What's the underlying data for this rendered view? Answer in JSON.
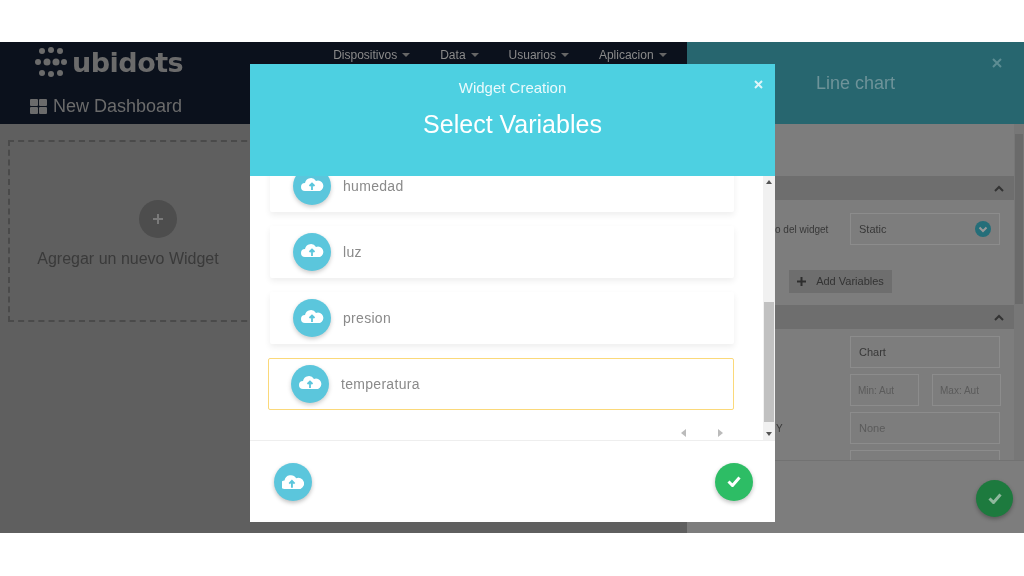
{
  "header": {
    "logo": "ubidots",
    "dashboard_title": "New Dashboard",
    "nav": [
      {
        "label": "Dispositivos"
      },
      {
        "label": "Data"
      },
      {
        "label": "Usuarios"
      },
      {
        "label": "Aplicacion"
      }
    ]
  },
  "dashboard": {
    "add_widget": "Agregar un nuevo Widget"
  },
  "panel": {
    "title": "Line chart",
    "sections": [
      {
        "expanded": true
      },
      {
        "expanded": true
      }
    ],
    "type_label": "o del widget",
    "type_value": "Static",
    "add_variables": "Add Variables",
    "title_value": "Chart",
    "min_placeholder": "Min: Aut",
    "max_placeholder": "Max: Aut",
    "y_label": "Y",
    "y_placeholder": "None"
  },
  "modal": {
    "subtitle": "Widget Creation",
    "title": "Select Variables",
    "variables": [
      {
        "name": "humedad",
        "selected": false
      },
      {
        "name": "luz",
        "selected": false
      },
      {
        "name": "presion",
        "selected": false
      },
      {
        "name": "temperatura",
        "selected": true
      }
    ]
  }
}
